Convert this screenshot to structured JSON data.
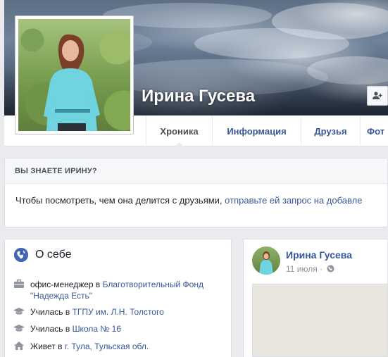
{
  "profile": {
    "name": "Ирина Гусева"
  },
  "tabs": [
    {
      "label": "Хроника"
    },
    {
      "label": "Информация"
    },
    {
      "label": "Друзья"
    },
    {
      "label": "Фот"
    }
  ],
  "know": {
    "header": "ВЫ ЗНАЕТЕ ИРИНУ?",
    "text": "Чтобы посмотреть, чем она делится с друзьями, ",
    "link": "отправьте ей запрос на добавле"
  },
  "about": {
    "title": "О себе",
    "rows": [
      {
        "icon": "briefcase-icon",
        "prefix": "офис-менеджер в ",
        "link": "Благотворительный Фонд \"Надежда Есть\""
      },
      {
        "icon": "graduation-cap-icon",
        "prefix": "Училась в ",
        "link": "ТГПУ им. Л.Н. Толстого"
      },
      {
        "icon": "graduation-cap-icon",
        "prefix": "Училась в ",
        "link": "Школа № 16"
      },
      {
        "icon": "home-icon",
        "prefix": "Живет в ",
        "link": "г. Тула, Тульская обл."
      }
    ]
  },
  "post": {
    "author": "Ирина Гусева",
    "date": "11 июля ·"
  },
  "colors": {
    "link": "#365899",
    "background": "#e9ebee"
  }
}
